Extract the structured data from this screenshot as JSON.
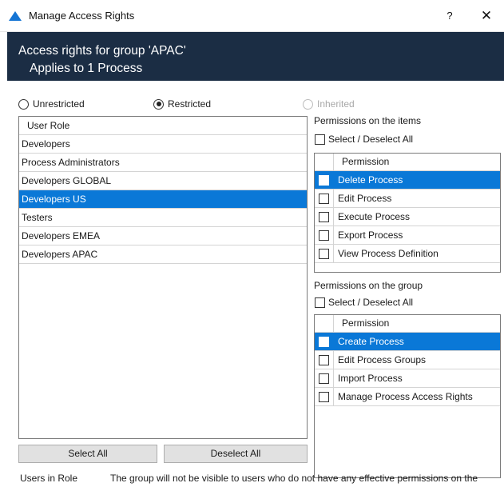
{
  "window": {
    "title": "Manage Access Rights",
    "help_glyph": "?",
    "close_glyph": "✕"
  },
  "header": {
    "title": "Access rights for group 'APAC'",
    "subtitle": "Applies to 1 Process"
  },
  "access_mode": {
    "options": [
      {
        "label": "Unrestricted",
        "checked": false,
        "disabled": false
      },
      {
        "label": "Restricted",
        "checked": true,
        "disabled": false
      },
      {
        "label": "Inherited",
        "checked": false,
        "disabled": true
      }
    ]
  },
  "roles": {
    "column_header": "User Role",
    "items": [
      {
        "label": "Developers",
        "selected": false
      },
      {
        "label": "Process Administrators",
        "selected": false
      },
      {
        "label": "Developers GLOBAL",
        "selected": false
      },
      {
        "label": "Developers US",
        "selected": true
      },
      {
        "label": "Testers",
        "selected": false
      },
      {
        "label": "Developers EMEA",
        "selected": false
      },
      {
        "label": "Developers APAC",
        "selected": false
      }
    ],
    "select_all_label": "Select All",
    "deselect_all_label": "Deselect All"
  },
  "item_permissions": {
    "section_label": "Permissions on the items",
    "select_deselect_label": "Select / Deselect All",
    "column_header": "Permission",
    "items": [
      {
        "label": "Delete Process",
        "checked": false,
        "selected": true
      },
      {
        "label": "Edit Process",
        "checked": false,
        "selected": false
      },
      {
        "label": "Execute Process",
        "checked": false,
        "selected": false
      },
      {
        "label": "Export Process",
        "checked": false,
        "selected": false
      },
      {
        "label": "View Process Definition",
        "checked": false,
        "selected": false
      }
    ]
  },
  "group_permissions": {
    "section_label": "Permissions on the group",
    "select_deselect_label": "Select / Deselect All",
    "column_header": "Permission",
    "items": [
      {
        "label": "Create Process",
        "checked": false,
        "selected": true
      },
      {
        "label": "Edit Process Groups",
        "checked": false,
        "selected": false
      },
      {
        "label": "Import Process",
        "checked": false,
        "selected": false
      },
      {
        "label": "Manage Process Access Rights",
        "checked": false,
        "selected": false
      }
    ]
  },
  "footer": {
    "users_in_role_label": "Users in Role",
    "visibility_note": "The group will not be visible to users who do not have any effective permissions on the group."
  },
  "colors": {
    "header_bg": "#1b2d44",
    "selection": "#0a78d7",
    "app_icon": "#1474d4"
  }
}
